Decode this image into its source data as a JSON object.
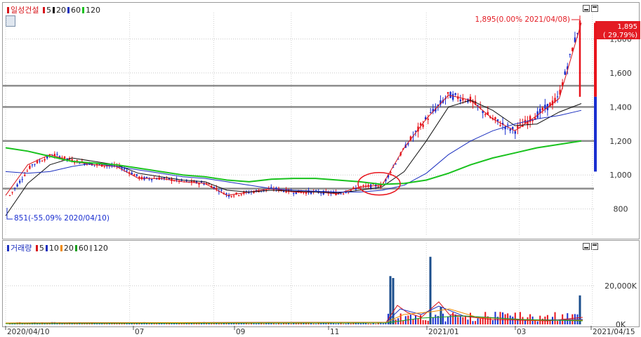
{
  "price_pane": {
    "legend": {
      "name": "일성건설",
      "items": [
        {
          "label": "5",
          "color": "#d7141a"
        },
        {
          "label": "20",
          "color": "#111111"
        },
        {
          "label": "60",
          "color": "#1b2fbf"
        },
        {
          "label": "120",
          "color": "#19c21e"
        }
      ]
    },
    "max_annotation": "1,895(0.00% 2021/04/08)",
    "min_annotation": "851(-55.09% 2020/04/10)",
    "current_price_label": "1,895",
    "current_change_label": "( 29.79%)"
  },
  "volume_pane": {
    "legend": {
      "name": "거래량",
      "items": [
        {
          "label": "5",
          "color": "#d7141a"
        },
        {
          "label": "10",
          "color": "#1b2fbf"
        },
        {
          "label": "20",
          "color": "#f08a00"
        },
        {
          "label": "60",
          "color": "#19a01e"
        },
        {
          "label": "120",
          "color": "#999999"
        }
      ]
    }
  },
  "x_axis": {
    "labels": [
      "2020/04/10",
      "07",
      "09",
      "11",
      "2021/01",
      "03",
      "2021/04/15"
    ]
  },
  "chart_data": [
    {
      "type": "candlestick",
      "title": "일성건설",
      "ylim": [
        650,
        1930
      ],
      "yticks": [
        800,
        1000,
        1200,
        1400,
        1600,
        1800
      ],
      "ytick_labels": [
        "800",
        "1,000",
        "1,200",
        "1,400",
        "1,600",
        "1,800"
      ],
      "grid": true,
      "horizontal_lines": [
        1525,
        1400,
        1200,
        920
      ],
      "highlight_circle": {
        "x_label": "12",
        "y": 940
      },
      "x": [
        "2020/04/10",
        "04/20",
        "04/30",
        "05/15",
        "05/30",
        "06/15",
        "06/30",
        "07/15",
        "07/30",
        "08/15",
        "08/30",
        "09/15",
        "09/30",
        "10/15",
        "10/30",
        "11/15",
        "11/30",
        "12/10",
        "12/20",
        "2021/01/05",
        "01/15",
        "01/30",
        "02/15",
        "02/28",
        "03/15",
        "03/30",
        "04/08"
      ],
      "series": [
        {
          "name": "5",
          "color": "#d7141a",
          "values": [
            880,
            1060,
            1120,
            1080,
            1060,
            1050,
            980,
            980,
            960,
            950,
            880,
            900,
            920,
            900,
            900,
            890,
            930,
            940,
            1160,
            1330,
            1470,
            1440,
            1330,
            1260,
            1350,
            1450,
            1895
          ]
        },
        {
          "name": "20",
          "color": "#111111",
          "values": [
            760,
            950,
            1060,
            1100,
            1080,
            1060,
            1010,
            990,
            970,
            960,
            910,
            900,
            910,
            905,
            900,
            895,
            910,
            930,
            1020,
            1200,
            1400,
            1440,
            1380,
            1290,
            1300,
            1370,
            1420
          ]
        },
        {
          "name": "60",
          "color": "#1b2fbf",
          "values": [
            1020,
            1010,
            1020,
            1050,
            1070,
            1050,
            1030,
            1010,
            990,
            980,
            960,
            940,
            920,
            910,
            905,
            900,
            900,
            910,
            940,
            1010,
            1120,
            1200,
            1260,
            1300,
            1330,
            1350,
            1380
          ]
        },
        {
          "name": "120",
          "color": "#19c21e",
          "values": [
            1160,
            1140,
            1110,
            1080,
            1070,
            1060,
            1040,
            1020,
            1000,
            990,
            970,
            960,
            975,
            980,
            980,
            970,
            960,
            945,
            950,
            970,
            1010,
            1060,
            1100,
            1130,
            1160,
            1180,
            1200
          ]
        }
      ]
    },
    {
      "type": "bar",
      "title": "거래량",
      "ylim": [
        0,
        40000
      ],
      "yticks": [
        0,
        20000
      ],
      "ytick_labels": [
        "0K",
        "20,000K"
      ],
      "spikes": [
        {
          "x": "2020/12/10",
          "value": 25000
        },
        {
          "x": "2020/12/12",
          "value": 24000
        },
        {
          "x": "2021/01/05",
          "value": 35000
        },
        {
          "x": "2021/01/20",
          "value": 9000
        },
        {
          "x": "2021/04/08",
          "value": 15000
        }
      ]
    }
  ]
}
